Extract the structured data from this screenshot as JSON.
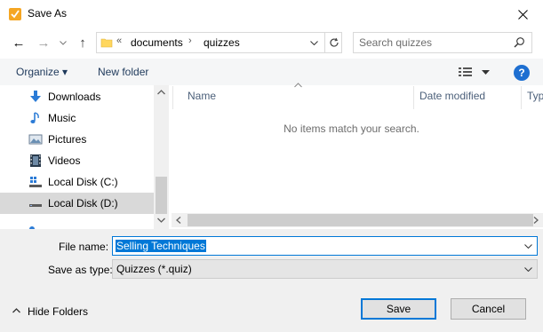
{
  "window": {
    "title": "Save As",
    "close_glyph": "✕"
  },
  "nav": {
    "back_glyph": "←",
    "forward_glyph": "→",
    "recent_glyph": "˅",
    "up_glyph": "↑"
  },
  "address": {
    "prefix": "«",
    "crumbs": [
      "documents",
      "quizzes"
    ],
    "separator": "›"
  },
  "search": {
    "placeholder": "Search quizzes"
  },
  "toolbar": {
    "organize_label": "Organize ▾",
    "new_folder_label": "New folder",
    "help_label": "?"
  },
  "sidebar": {
    "items": [
      {
        "label": "Downloads",
        "icon": "download-icon"
      },
      {
        "label": "Music",
        "icon": "music-icon"
      },
      {
        "label": "Pictures",
        "icon": "pictures-icon"
      },
      {
        "label": "Videos",
        "icon": "videos-icon"
      },
      {
        "label": "Local Disk (C:)",
        "icon": "disk-icon"
      },
      {
        "label": "Local Disk (D:)",
        "icon": "disk-icon",
        "selected": true
      }
    ]
  },
  "columns": {
    "name": "Name",
    "date_modified": "Date modified",
    "type": "Typ"
  },
  "content": {
    "empty_message": "No items match your search."
  },
  "fields": {
    "file_name_label": "File name:",
    "file_name_value": "Selling Techniques",
    "save_type_label": "Save as type:",
    "save_type_value": "Quizzes (*.quiz)"
  },
  "footer": {
    "hide_folders_label": "Hide Folders",
    "save_label": "Save",
    "cancel_label": "Cancel"
  },
  "colors": {
    "accent": "#0078d7",
    "link_text": "#1e395b",
    "app_icon": "#f5a623"
  }
}
